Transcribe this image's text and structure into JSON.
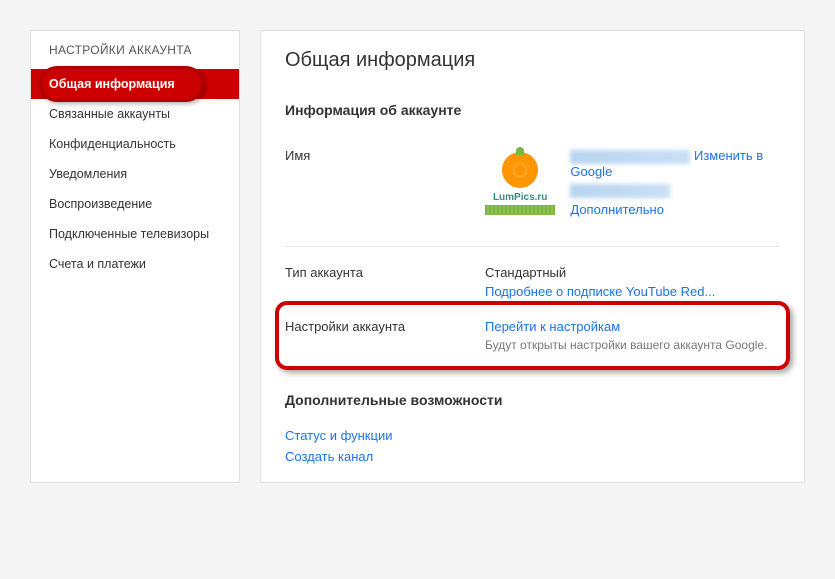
{
  "sidebar": {
    "header": "НАСТРОЙКИ АККАУНТА",
    "items": [
      {
        "label": "Общая информация"
      },
      {
        "label": "Связанные аккаунты"
      },
      {
        "label": "Конфиденциальность"
      },
      {
        "label": "Уведомления"
      },
      {
        "label": "Воспроизведение"
      },
      {
        "label": "Подключенные телевизоры"
      },
      {
        "label": "Счета и платежи"
      }
    ]
  },
  "main": {
    "title": "Общая информация",
    "accountInfo": {
      "sectionTitle": "Информация об аккаунте",
      "nameLabel": "Имя",
      "avatarText": "LumPics.ru",
      "changeInGoogle": "Изменить в Google",
      "advanced": "Дополнительно",
      "accountTypeLabel": "Тип аккаунта",
      "accountTypeValue": "Стандартный",
      "youtubeRedLink": "Подробнее о подписке YouTube Red...",
      "settingsLabel": "Настройки аккаунта",
      "goToSettings": "Перейти к настройкам",
      "settingsNote": "Будут открыты настройки вашего аккаунта Google."
    },
    "extra": {
      "title": "Дополнительные возможности",
      "statusLink": "Статус и функции",
      "createChannelLink": "Создать канал"
    }
  }
}
